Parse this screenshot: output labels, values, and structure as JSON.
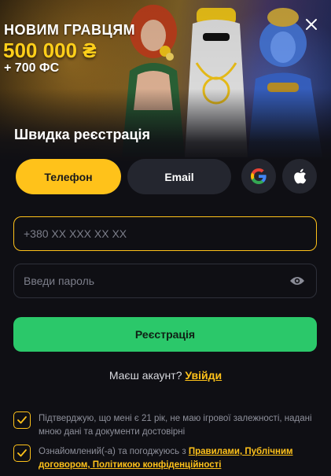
{
  "banner": {
    "line1": "НОВИМ ГРАВЦЯМ",
    "line2": "500 000 ₴",
    "line3": "+ 700 ФС",
    "close_icon": "close-icon",
    "colors": {
      "accent": "#ffcf1a"
    }
  },
  "sheet": {
    "title": "Швидка реєстрація"
  },
  "tabs": {
    "phone": "Телефон",
    "email": "Email",
    "google_icon": "google-icon",
    "apple_icon": "apple-icon"
  },
  "form": {
    "phone_placeholder": "+380 XX XXX XX XX",
    "password_placeholder": "Введи пароль",
    "eye_icon": "eye-icon",
    "submit": "Реєстрація"
  },
  "login": {
    "prompt": "Маєш акаунт?",
    "link": "Увійди"
  },
  "consents": {
    "age": "Підтверджую, що мені є 21 рік, не маю ігрової залежності, надані мною дані та документи достовірні",
    "terms_prefix": "Ознайомлений(-а) та погоджуюсь з",
    "terms_links": "Правилами, Публічним договором, Політикою конфіденційності",
    "check_icon": "check-icon"
  },
  "colors": {
    "yellow": "#ffc21a",
    "green": "#2bc86a",
    "background": "#0f0f14",
    "surface": "#24262f"
  }
}
